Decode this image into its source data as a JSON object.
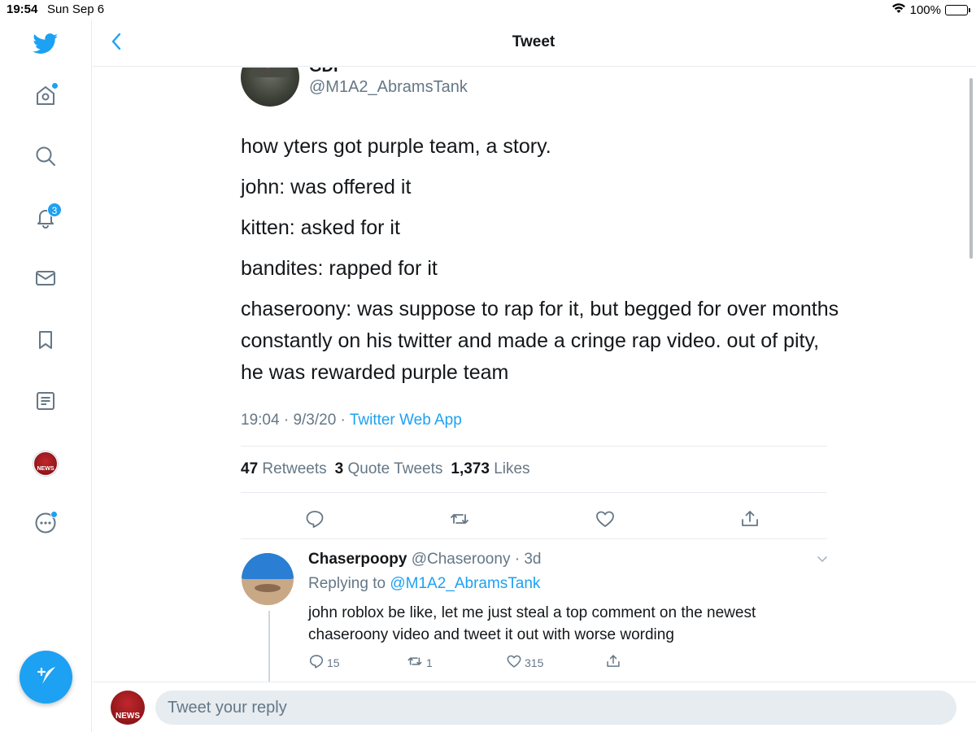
{
  "status_bar": {
    "time": "19:54",
    "date": "Sun Sep 6",
    "battery": "100%",
    "battery_level": 1.0
  },
  "sidebar": {
    "items": [
      {
        "name": "twitter-logo",
        "icon": "bird-icon"
      },
      {
        "name": "home",
        "icon": "home-icon",
        "has_dot": true
      },
      {
        "name": "explore",
        "icon": "search-icon"
      },
      {
        "name": "notifications",
        "icon": "bell-icon",
        "badge": "3"
      },
      {
        "name": "messages",
        "icon": "mail-icon"
      },
      {
        "name": "bookmarks",
        "icon": "bookmark-icon"
      },
      {
        "name": "lists",
        "icon": "list-icon"
      },
      {
        "name": "profile",
        "icon": "avatar",
        "label": "NEWS"
      },
      {
        "name": "more",
        "icon": "more-icon",
        "has_dot": true
      }
    ],
    "compose_icon": "feather-plus-icon"
  },
  "header": {
    "title": "Tweet",
    "back_icon": "chevron-left-icon"
  },
  "tweet": {
    "author_name": "GDI",
    "author_handle": "@M1A2_AbramsTank",
    "lines": [
      "how yters got purple team, a story.",
      "john: was offered it",
      "kitten: asked for it",
      "bandites: rapped for it",
      "chaseroony: was suppose to rap for it, but begged for over months constantly on his twitter and made a cringe rap video. out of pity, he was rewarded purple team"
    ],
    "time": "19:04",
    "date": "9/3/20",
    "source": "Twitter Web App",
    "retweets_count": "47",
    "retweets_label": "Retweets",
    "quotes_count": "3",
    "quotes_label": "Quote Tweets",
    "likes_count": "1,373",
    "likes_label": "Likes"
  },
  "reply": {
    "name": "Chaserpoopy",
    "handle": "@Chaseroony",
    "age": "3d",
    "replying_label": "Replying to",
    "replying_to": "@M1A2_AbramsTank",
    "text": "john roblox be like, let me just steal a top comment on the newest chaseroony video and tweet it out with worse wording",
    "reply_count": "15",
    "retweet_count": "1",
    "like_count": "315"
  },
  "composer": {
    "avatar_label": "NEWS",
    "placeholder": "Tweet your reply"
  },
  "colors": {
    "accent": "#1da1f2",
    "text": "#14171a",
    "secondary": "#657786",
    "border": "#e6ecf0"
  }
}
